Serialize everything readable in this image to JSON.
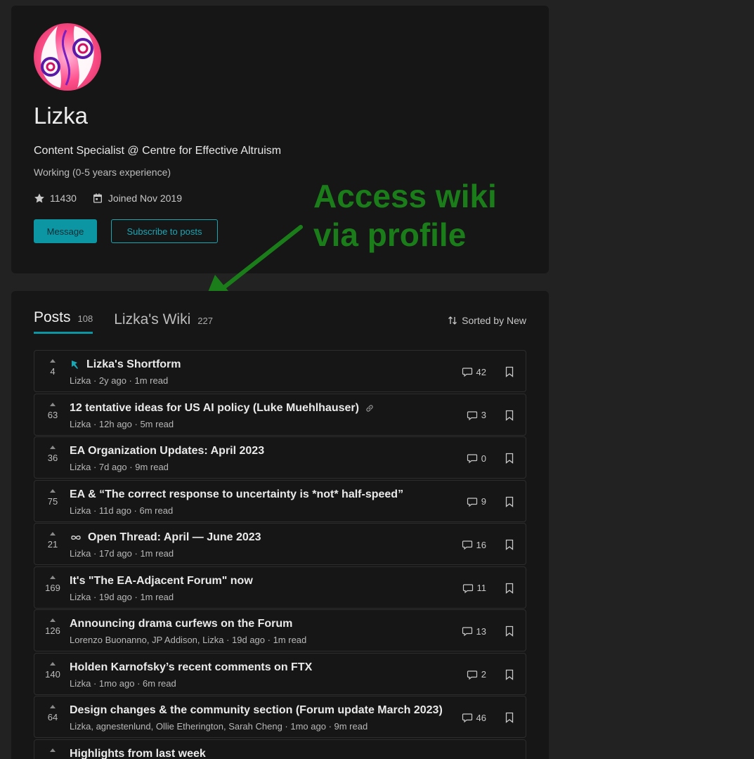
{
  "profile": {
    "display_name": "Lizka",
    "headline": "Content Specialist @ Centre for Effective Altruism",
    "career_stage": "Working (0-5 years experience)",
    "karma": "11430",
    "joined": "Joined Nov 2019",
    "message_label": "Message",
    "subscribe_label": "Subscribe to posts"
  },
  "annotation": {
    "text": "Access wiki\nvia profile",
    "color": "#1a7d1a"
  },
  "tabs": [
    {
      "label": "Posts",
      "count": "108",
      "active": true
    },
    {
      "label": "Lizka's Wiki",
      "count": "227",
      "active": false
    }
  ],
  "sort_label": "Sorted by New",
  "accent_color": "#0c96a4",
  "posts": [
    {
      "score": "4",
      "title": "Lizka's Shortform",
      "meta": "Lizka · 2y ago · 1m read",
      "comments": "42",
      "pre_icon": "pin-icon"
    },
    {
      "score": "63",
      "title": "12 tentative ideas for US AI policy (Luke Muehlhauser)",
      "meta": "Lizka · 12h ago · 5m read",
      "comments": "3",
      "post_icon": "link-icon"
    },
    {
      "score": "36",
      "title": "EA Organization Updates: April 2023",
      "meta": "Lizka · 7d ago · 9m read",
      "comments": "0"
    },
    {
      "score": "75",
      "title": "EA & “The correct response to uncertainty is *not* half-speed”",
      "meta": "Lizka · 11d ago · 6m read",
      "comments": "9"
    },
    {
      "score": "21",
      "title": "Open Thread: April — June 2023",
      "meta": "Lizka · 17d ago · 1m read",
      "comments": "16",
      "pre_icon": "infinity-icon"
    },
    {
      "score": "169",
      "title": "It's \"The EA-Adjacent Forum\" now",
      "meta": "Lizka · 19d ago · 1m read",
      "comments": "11"
    },
    {
      "score": "126",
      "title": "Announcing drama curfews on the Forum",
      "meta": "Lorenzo Buonanno, JP Addison, Lizka · 19d ago · 1m read",
      "comments": "13"
    },
    {
      "score": "140",
      "title": "Holden Karnofsky’s recent comments on FTX",
      "meta": "Lizka · 1mo ago · 6m read",
      "comments": "2"
    },
    {
      "score": "64",
      "title": "Design changes & the community section (Forum update March 2023)",
      "meta": "Lizka, agnestenlund, Ollie Etherington, Sarah Cheng · 1mo ago · 9m read",
      "comments": "46"
    },
    {
      "score": "",
      "title": "Highlights from last week",
      "meta": "",
      "comments": ""
    }
  ]
}
